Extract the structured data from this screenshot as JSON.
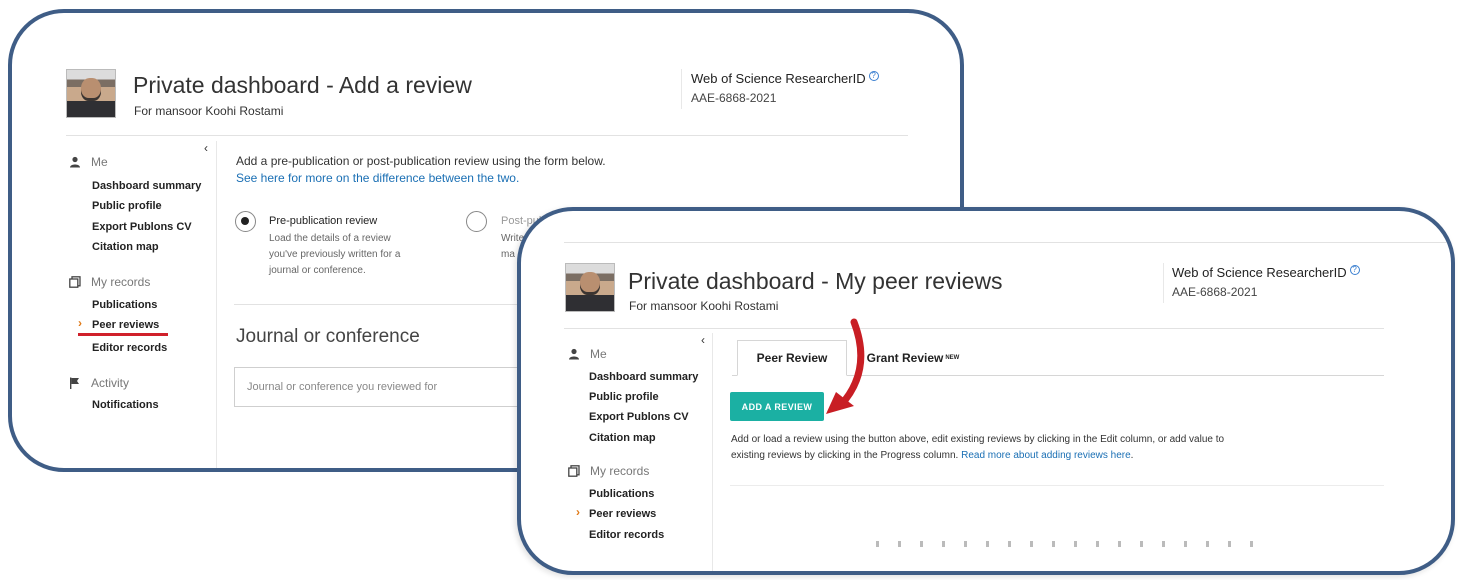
{
  "back_panel": {
    "title": "Private dashboard - Add a review",
    "subtitle": "For mansoor Koohi Rostami",
    "researcher_id": {
      "label": "Web of Science ResearcherID",
      "value": "AAE-6868-2021",
      "info_icon": "?"
    },
    "collapse_icon": "‹",
    "sidebar": {
      "me": {
        "label": "Me",
        "items": [
          "Dashboard summary",
          "Public profile",
          "Export Publons CV",
          "Citation map"
        ]
      },
      "records": {
        "label": "My records",
        "items": [
          "Publications",
          "Peer reviews",
          "Editor records"
        ],
        "active": "Peer reviews"
      },
      "activity": {
        "label": "Activity",
        "items": [
          "Notifications"
        ]
      }
    },
    "intro": "Add a pre-publication or post-publication review using the form below.",
    "intro_link": "See here for more on the difference between the two.",
    "option_pre": {
      "title": "Pre-publication review",
      "desc": [
        "Load the details of a review",
        "you've previously written for a",
        "journal or conference."
      ]
    },
    "option_post": {
      "title": "Post-pub",
      "desc": [
        "Write",
        "ma"
      ]
    },
    "journal_heading": "Journal or conference",
    "journal_placeholder": "Journal or conference you reviewed for"
  },
  "front_panel": {
    "title": "Private dashboard - My peer reviews",
    "subtitle": "For mansoor Koohi Rostami",
    "researcher_id": {
      "label": "Web of Science ResearcherID",
      "value": "AAE-6868-2021",
      "info_icon": "?"
    },
    "collapse_icon": "‹",
    "sidebar": {
      "me": {
        "label": "Me",
        "items": [
          "Dashboard summary",
          "Public profile",
          "Export Publons CV",
          "Citation map"
        ]
      },
      "records": {
        "label": "My records",
        "items": [
          "Publications",
          "Peer reviews",
          "Editor records"
        ],
        "active": "Peer reviews"
      }
    },
    "tabs": [
      {
        "label": "Peer Review",
        "active": true
      },
      {
        "label": "Grant Review",
        "badge": "NEW",
        "active": false
      }
    ],
    "add_button": "ADD A REVIEW",
    "help_line1": "Add or load a review using the button above, edit existing reviews by clicking in the Edit column, or add value to",
    "help_line2": "existing reviews by clicking in the Progress column.",
    "help_link": "Read more about adding reviews here",
    "help_end": "."
  },
  "colors": {
    "panel_border": "#3f5d86",
    "accent_teal": "#1bb0a3",
    "highlight_red": "#d0202a",
    "link_blue": "#1a6fb4",
    "active_chevron": "#e07b1a"
  }
}
